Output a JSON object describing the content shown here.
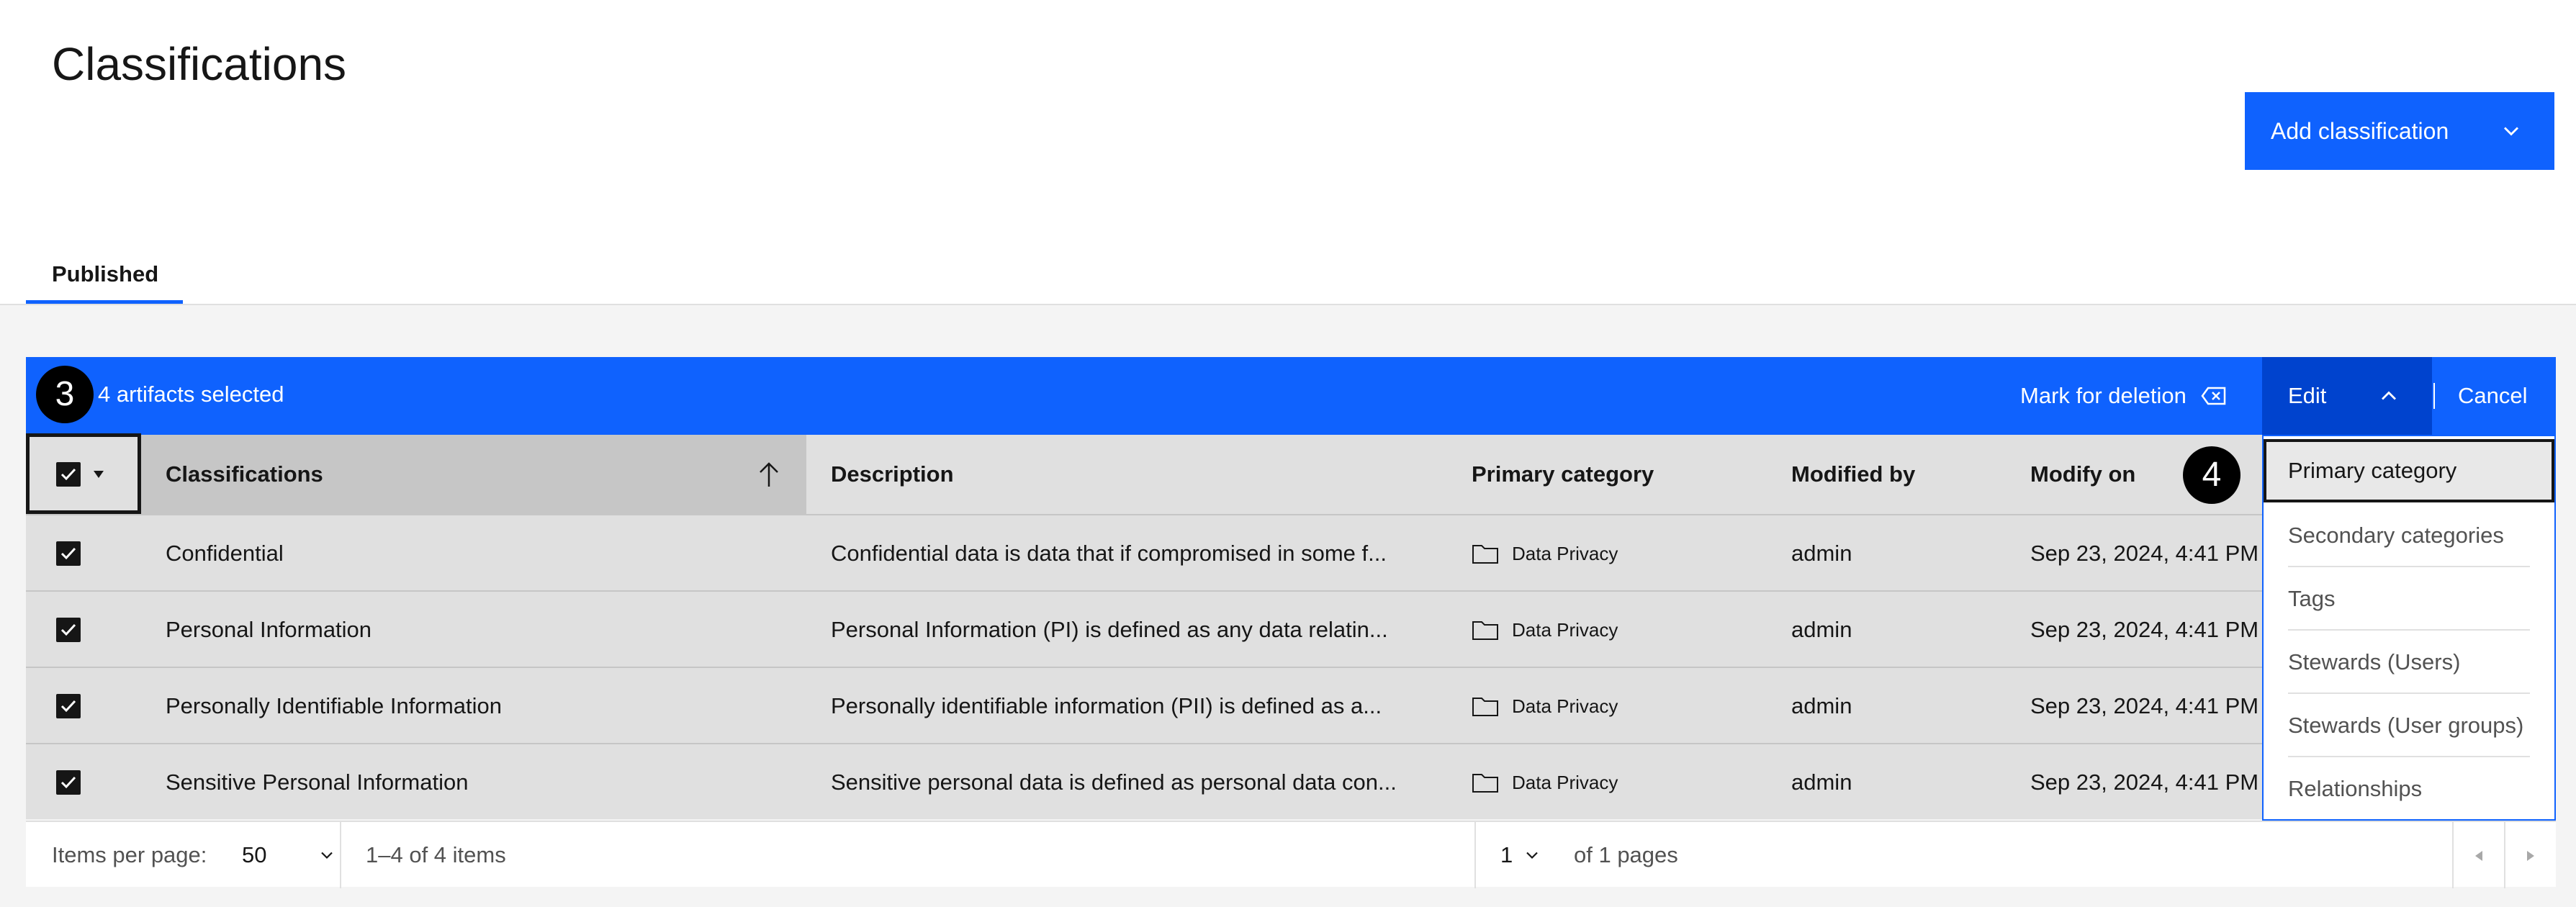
{
  "page": {
    "title": "Classifications"
  },
  "header": {
    "add_button_label": "Add classification"
  },
  "tabs": [
    {
      "label": "Published"
    }
  ],
  "batch_bar": {
    "selected_text": "4 artifacts selected",
    "mark_for_deletion": "Mark for deletion",
    "edit_label": "Edit",
    "cancel_label": "Cancel"
  },
  "table": {
    "columns": [
      "Classifications",
      "Description",
      "Primary category",
      "Modified by",
      "Modify on"
    ],
    "rows": [
      {
        "name": "Confidential",
        "description": "Confidential data is data that if compromised in some f...",
        "category": "Data Privacy",
        "modified_by": "admin",
        "modified_on": "Sep 23, 2024, 4:41 PM"
      },
      {
        "name": "Personal Information",
        "description": "Personal Information (PI) is defined as any data relatin...",
        "category": "Data Privacy",
        "modified_by": "admin",
        "modified_on": "Sep 23, 2024, 4:41 PM"
      },
      {
        "name": "Personally Identifiable Information",
        "description": "Personally identifiable information (PII) is defined as a...",
        "category": "Data Privacy",
        "modified_by": "admin",
        "modified_on": "Sep 23, 2024, 4:41 PM"
      },
      {
        "name": "Sensitive Personal Information",
        "description": "Sensitive personal data is defined as personal data con...",
        "category": "Data Privacy",
        "modified_by": "admin",
        "modified_on": "Sep 23, 2024, 4:41 PM"
      }
    ]
  },
  "pagination": {
    "items_per_page_label": "Items per page:",
    "items_per_page_value": "50",
    "range_text": "1–4 of 4 items",
    "page_value": "1",
    "pages_text": "of 1 pages"
  },
  "edit_menu": {
    "items": [
      "Primary category",
      "Secondary categories",
      "Tags",
      "Stewards (Users)",
      "Stewards (User groups)",
      "Relationships"
    ]
  },
  "callouts": {
    "step_3": "3",
    "step_4": "4"
  },
  "colors": {
    "accent": "#0f62fe",
    "accent_dark": "#0043ce",
    "row_bg": "#e0e0e0",
    "page_bg": "#f4f4f4"
  },
  "icons": [
    "chevron-down-icon",
    "chevron-up-icon",
    "sort-arrow-up-icon",
    "delete-icon",
    "folder-icon",
    "checkbox-checked-icon",
    "caret-down-icon",
    "caret-left-icon",
    "caret-right-icon"
  ]
}
